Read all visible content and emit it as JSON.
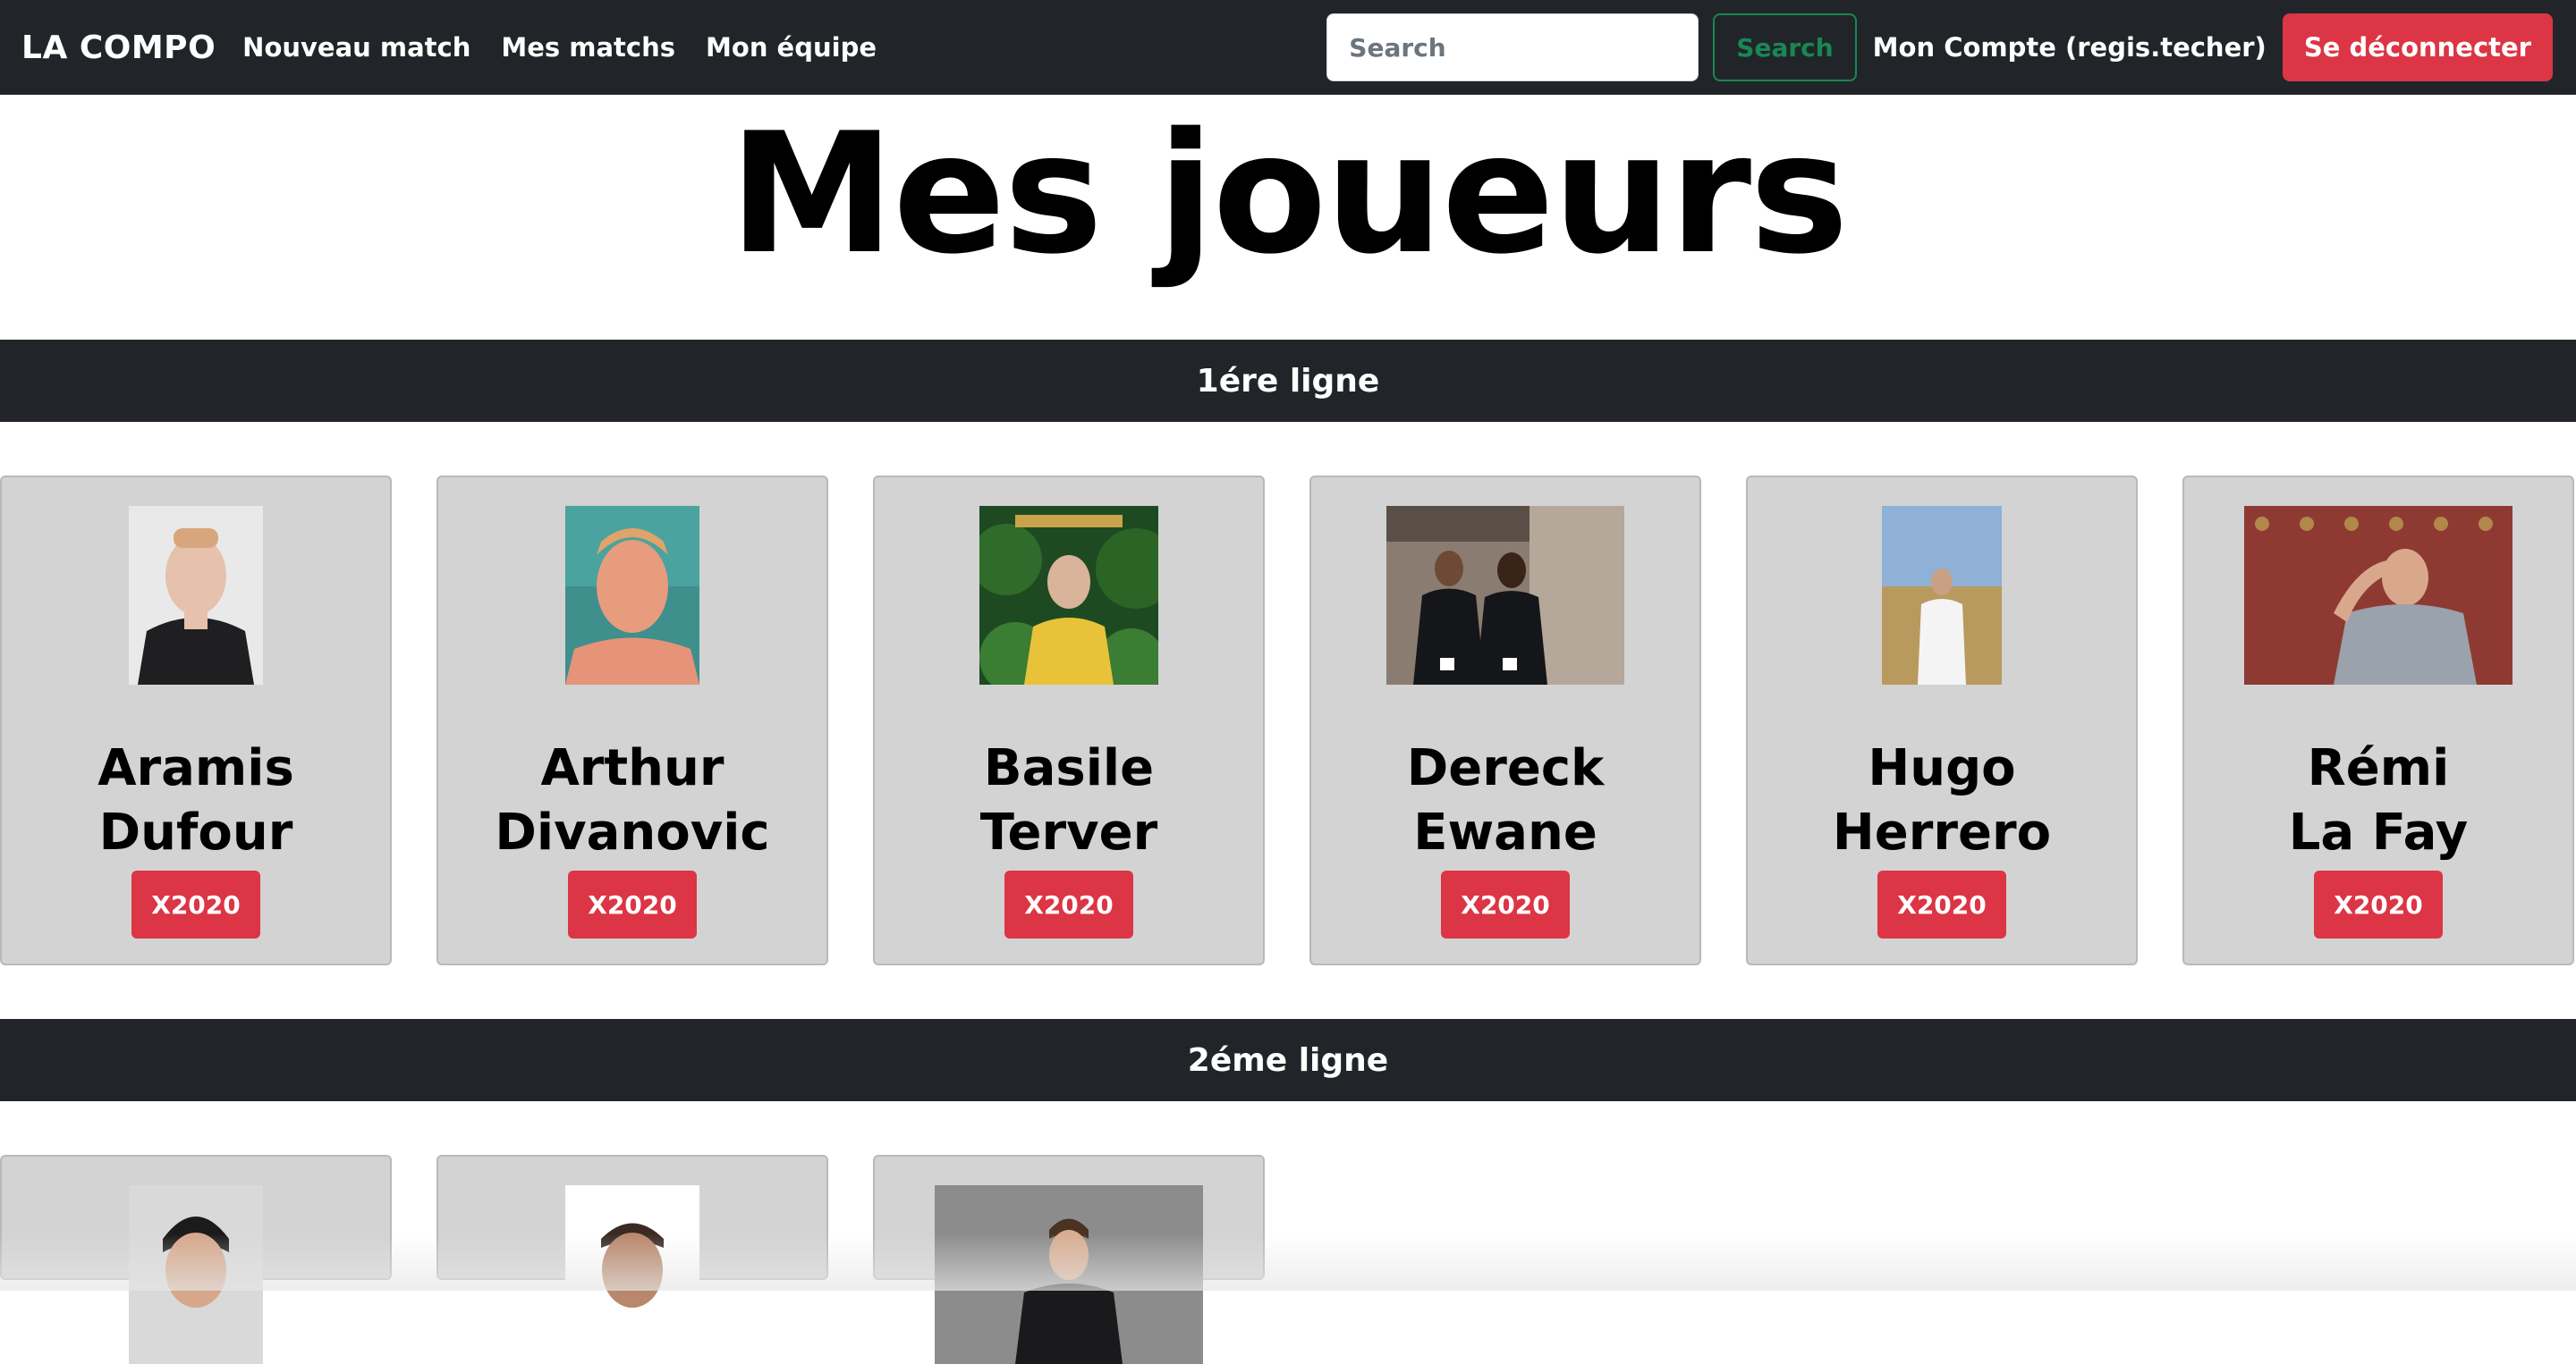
{
  "navbar": {
    "brand": "LA COMPO",
    "links": [
      "Nouveau match",
      "Mes matchs",
      "Mon équipe"
    ],
    "search_placeholder": "Search",
    "search_button": "Search",
    "account": "Mon Compte (regis.techer)",
    "logout": "Se déconnecter"
  },
  "page_title": "Mes joueurs",
  "sections": [
    {
      "title": "1ére ligne",
      "players": [
        {
          "first": "Aramis",
          "last": "Dufour",
          "badge": "X2020"
        },
        {
          "first": "Arthur",
          "last": "Divanovic",
          "badge": "X2020"
        },
        {
          "first": "Basile",
          "last": "Terver",
          "badge": "X2020"
        },
        {
          "first": "Dereck",
          "last": "Ewane",
          "badge": "X2020"
        },
        {
          "first": "Hugo",
          "last": "Herrero",
          "badge": "X2020"
        },
        {
          "first": "Rémi",
          "last": "La Fay",
          "badge": "X2020"
        }
      ]
    },
    {
      "title": "2éme ligne",
      "players": [
        {
          "first": "",
          "last": "",
          "badge": ""
        },
        {
          "first": "",
          "last": "",
          "badge": ""
        },
        {
          "first": "",
          "last": "",
          "badge": ""
        }
      ]
    }
  ],
  "colors": {
    "navbar_bg": "#212529",
    "accent_red": "#dc3545",
    "accent_green": "#198754",
    "card_bg": "#d3d3d3"
  }
}
